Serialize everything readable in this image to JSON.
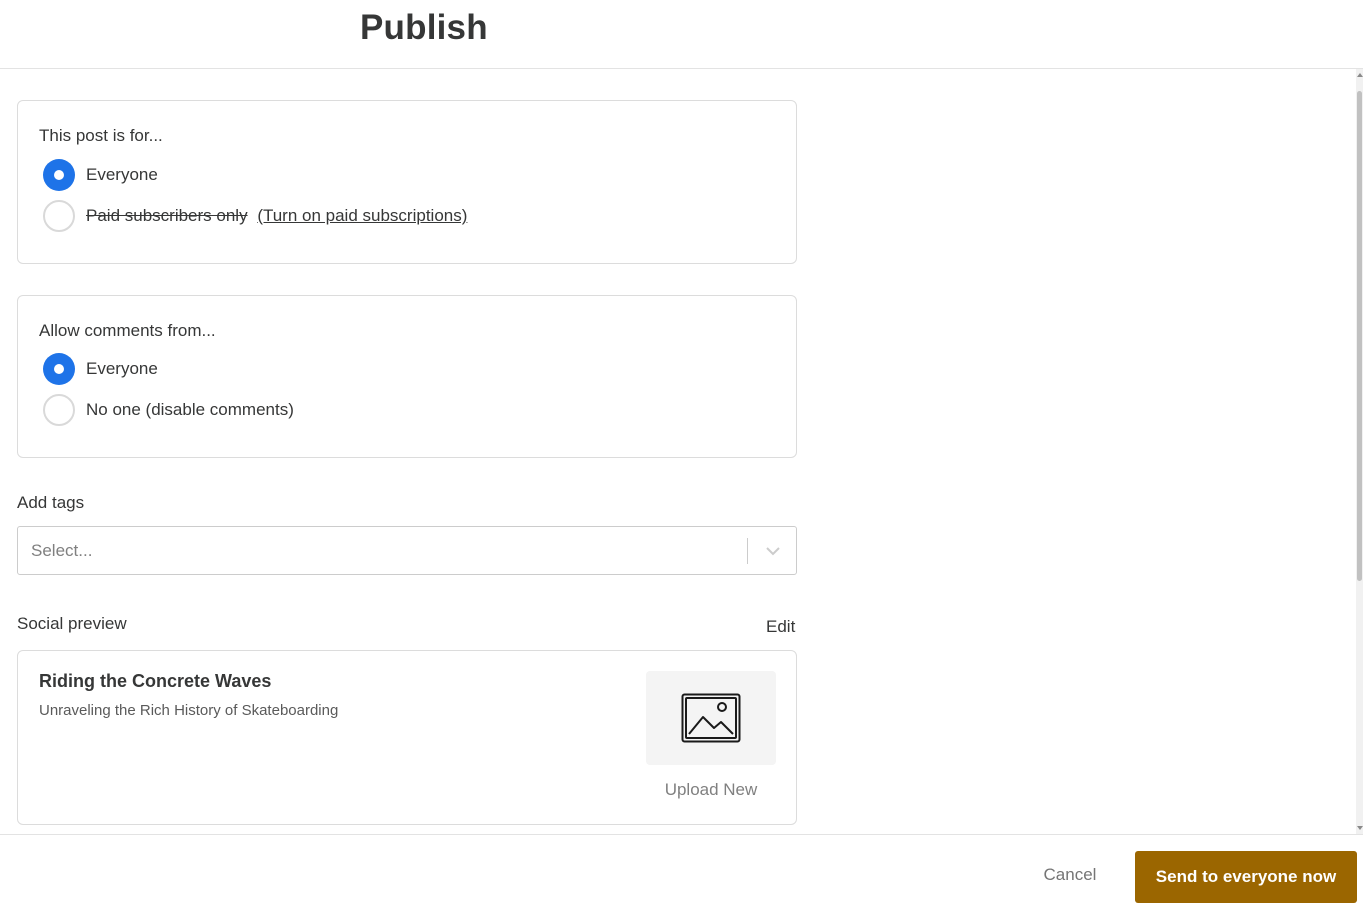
{
  "header": {
    "title": "Publish"
  },
  "audience": {
    "title": "This post is for...",
    "options": [
      {
        "label": "Everyone",
        "selected": true
      },
      {
        "label": "Paid subscribers only",
        "link": "(Turn on paid subscriptions)",
        "selected": false
      }
    ]
  },
  "comments": {
    "title": "Allow comments from...",
    "options": [
      {
        "label": "Everyone",
        "selected": true
      },
      {
        "label": "No one (disable comments)",
        "selected": false
      }
    ]
  },
  "tags": {
    "label": "Add tags",
    "placeholder": "Select..."
  },
  "social_preview": {
    "label": "Social preview",
    "edit_label": "Edit",
    "post_title": "Riding the Concrete Waves",
    "post_subtitle": "Unraveling the Rich History of Skateboarding",
    "image_icon": "image-icon",
    "upload_label": "Upload New"
  },
  "footer": {
    "cancel_label": "Cancel",
    "send_label": "Send to everyone now"
  },
  "colors": {
    "accent": "#1e73e8",
    "send_button": "#9b6600"
  }
}
